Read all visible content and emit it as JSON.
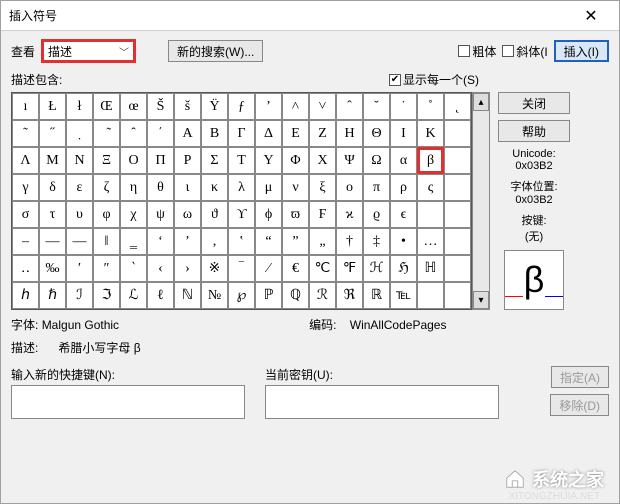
{
  "title": "插入符号",
  "lookup_label": "查看",
  "dropdown_value": "描述",
  "new_search_btn": "新的搜索(W)...",
  "bold_label": "粗体",
  "italic_label": "斜体(I",
  "insert_btn": "插入(I)",
  "contains_label": "描述包含:",
  "show_each_label": "显示每一个(S)",
  "close_btn": "关闭",
  "help_btn": "帮助",
  "unicode_label": "Unicode:",
  "unicode_value": "0x03B2",
  "fontpos_label": "字体位置:",
  "fontpos_value": "0x03B2",
  "keypress_label": "按键:",
  "keypress_value": "(无)",
  "preview_char": "β",
  "font_label": "字体:",
  "font_value": "Malgun Gothic",
  "encoding_label": "编码:",
  "encoding_value": "WinAllCodePages",
  "desc_label": "描述:",
  "desc_value": "希腊小写字母  β",
  "newshort_label": "输入新的快捷键(N):",
  "curkey_label": "当前密钥(U):",
  "assign_btn": "指定(A)",
  "remove_btn": "移除(D)",
  "watermark": "系统之家",
  "watermark_sub": "XITONGZHIJIA.NET",
  "grid": [
    [
      "ı",
      "Ł",
      "ł",
      "Œ",
      "œ",
      "Š",
      "š",
      "Ÿ",
      "ƒ",
      "ʼ",
      "˄",
      "˅",
      "ˆ",
      "˘",
      "˙",
      "˚",
      "˛"
    ],
    [
      "˜",
      "˝",
      "̣",
      "̃",
      "̑",
      "΄",
      "Α",
      "Β",
      "Γ",
      "Δ",
      "Ε",
      "Ζ",
      "Η",
      "Θ",
      "Ι",
      "Κ",
      ""
    ],
    [
      "Λ",
      "Μ",
      "Ν",
      "Ξ",
      "Ο",
      "Π",
      "Ρ",
      "Σ",
      "Τ",
      "Υ",
      "Φ",
      "Χ",
      "Ψ",
      "Ω",
      "α",
      "β",
      ""
    ],
    [
      "γ",
      "δ",
      "ε",
      "ζ",
      "η",
      "θ",
      "ι",
      "κ",
      "λ",
      "μ",
      "ν",
      "ξ",
      "ο",
      "π",
      "ρ",
      "ς",
      ""
    ],
    [
      "σ",
      "τ",
      "υ",
      "φ",
      "χ",
      "ψ",
      "ω",
      "ϑ",
      "ϒ",
      "ϕ",
      "ϖ",
      "Ϝ",
      "ϰ",
      "ϱ",
      "ϵ",
      "",
      " "
    ],
    [
      "–",
      "—",
      "―",
      "‖",
      "‗",
      "‘",
      "’",
      "‚",
      "‛",
      "“",
      "”",
      "„",
      "†",
      "‡",
      "•",
      "…",
      ""
    ],
    [
      "‥",
      "‰",
      "′",
      "″",
      "‵",
      "‹",
      "›",
      "※",
      "‾",
      "⁄",
      "€",
      "℃",
      "℉",
      "ℋ",
      "ℌ",
      "ℍ",
      ""
    ],
    [
      "ℎ",
      "ℏ",
      "ℐ",
      "ℑ",
      "ℒ",
      "ℓ",
      "ℕ",
      "№",
      "℘",
      "ℙ",
      "ℚ",
      "ℛ",
      "ℜ",
      "ℝ",
      "℡",
      "",
      ""
    ]
  ],
  "selected": {
    "r": 2,
    "c": 15
  }
}
